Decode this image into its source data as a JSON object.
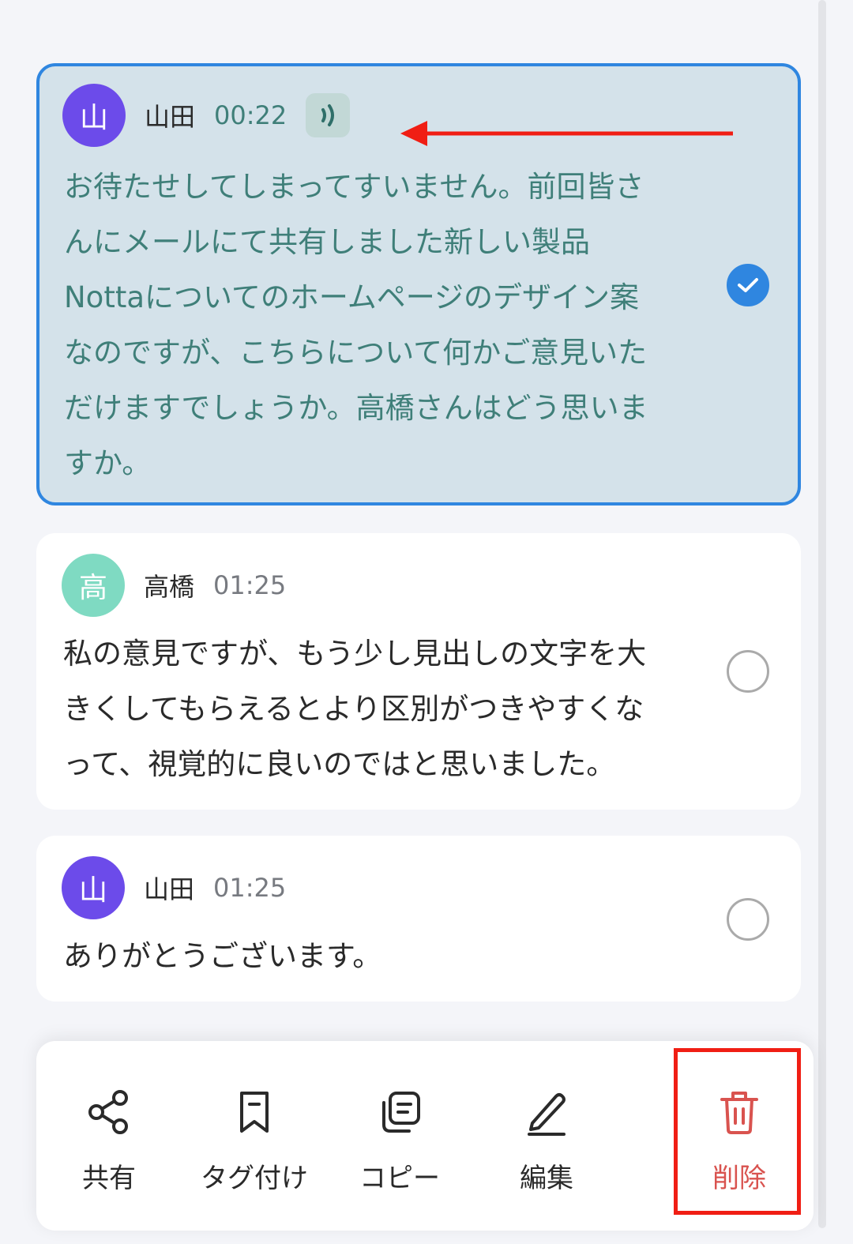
{
  "transcript": [
    {
      "avatar_text": "山",
      "avatar_color": "#6c4bea",
      "speaker": "山田",
      "time": "00:22",
      "audio_icon": "sound-wave-icon",
      "text": "お待たせしてしまってすいません。前回皆さ\nんにメールにて共有しました新しい製品\nNottaについてのホームページのデザイン案\nなのですが、こちらについて何かご意見いた\nだけますでしょうか。高橋さんはどう思いま\nすか。",
      "selected": true
    },
    {
      "avatar_text": "高",
      "avatar_color": "#7fdac2",
      "speaker": "高橋",
      "time": "01:25",
      "text": "私の意見ですが、もう少し見出しの文字を大\nきくしてもらえるとより区別がつきやすくな\nって、視覚的に良いのではと思いました。",
      "selected": false
    },
    {
      "avatar_text": "山",
      "avatar_color": "#6c4bea",
      "speaker": "山田",
      "time": "01:25",
      "text": "ありがとうございます。",
      "selected": false
    }
  ],
  "toolbar": {
    "share_label": "共有",
    "tag_label": "タグ付け",
    "copy_label": "コピー",
    "edit_label": "編集",
    "delete_label": "削除"
  },
  "colors": {
    "accent": "#2f86e0",
    "annotation_red": "#f01e14",
    "delete_red": "#d9534f"
  }
}
